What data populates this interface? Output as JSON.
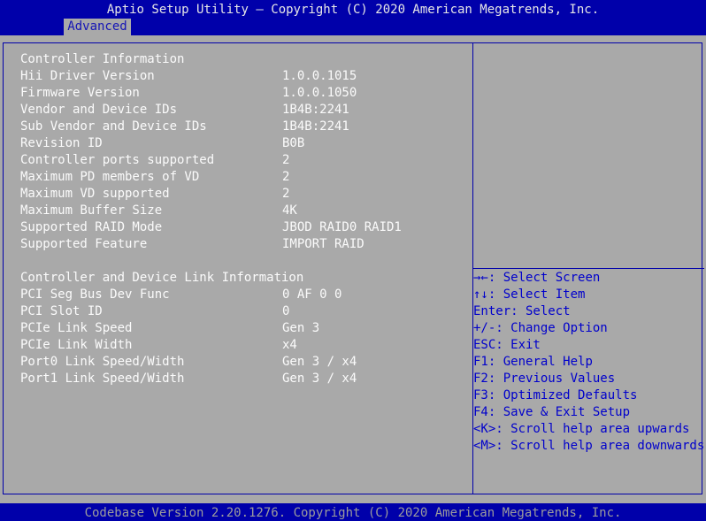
{
  "title": "Aptio Setup Utility – Copyright (C) 2020 American Megatrends, Inc.",
  "tabs": [
    {
      "label": "Advanced",
      "selected": true
    }
  ],
  "controller_info": {
    "heading": "Controller Information",
    "rows": [
      {
        "label": "Hii Driver Version",
        "value": "1.0.0.1015"
      },
      {
        "label": "Firmware Version",
        "value": "1.0.0.1050"
      },
      {
        "label": "Vendor and Device IDs",
        "value": "1B4B:2241"
      },
      {
        "label": "Sub Vendor and Device IDs",
        "value": "1B4B:2241"
      },
      {
        "label": "Revision ID",
        "value": "B0B"
      },
      {
        "label": "Controller ports supported",
        "value": "2"
      },
      {
        "label": "Maximum PD members of VD",
        "value": "2"
      },
      {
        "label": "Maximum VD supported",
        "value": "2"
      },
      {
        "label": "Maximum Buffer Size",
        "value": "4K"
      },
      {
        "label": "Supported RAID Mode",
        "value": "JBOD RAID0 RAID1"
      },
      {
        "label": "Supported Feature",
        "value": "IMPORT RAID"
      }
    ]
  },
  "link_info": {
    "heading": "Controller and Device Link Information",
    "rows": [
      {
        "label": "PCI Seg Bus Dev Func",
        "value": "0 AF 0 0"
      },
      {
        "label": "PCI Slot ID",
        "value": "0"
      },
      {
        "label": "PCIe Link Speed",
        "value": "Gen 3"
      },
      {
        "label": "PCIe Link Width",
        "value": "x4"
      },
      {
        "label": "Port0 Link Speed/Width",
        "value": "Gen 3 / x4"
      },
      {
        "label": "Port1 Link Speed/Width",
        "value": "Gen 3 / x4"
      }
    ]
  },
  "help": [
    {
      "key": "→←:",
      "text": " Select Screen"
    },
    {
      "key": "↑↓:",
      "text": " Select Item"
    },
    {
      "key": "Enter:",
      "text": " Select"
    },
    {
      "key": "+/-:",
      "text": " Change Option"
    },
    {
      "key": "ESC:",
      "text": " Exit"
    },
    {
      "key": "F1:",
      "text": " General Help"
    },
    {
      "key": "F2:",
      "text": " Previous Values"
    },
    {
      "key": "F3:",
      "text": " Optimized Defaults"
    },
    {
      "key": "F4:",
      "text": " Save & Exit Setup"
    },
    {
      "key": "<K>:",
      "text": " Scroll help area upwards"
    },
    {
      "key": "<M>:",
      "text": " Scroll help area downwards"
    }
  ],
  "status": "Codebase Version 2.20.1276. Copyright (C) 2020 American Megatrends, Inc.",
  "colors": {
    "background": "#0000aa",
    "panel": "#a9a9a9",
    "text": "#fbfbfb",
    "help_text": "#0000cc"
  }
}
